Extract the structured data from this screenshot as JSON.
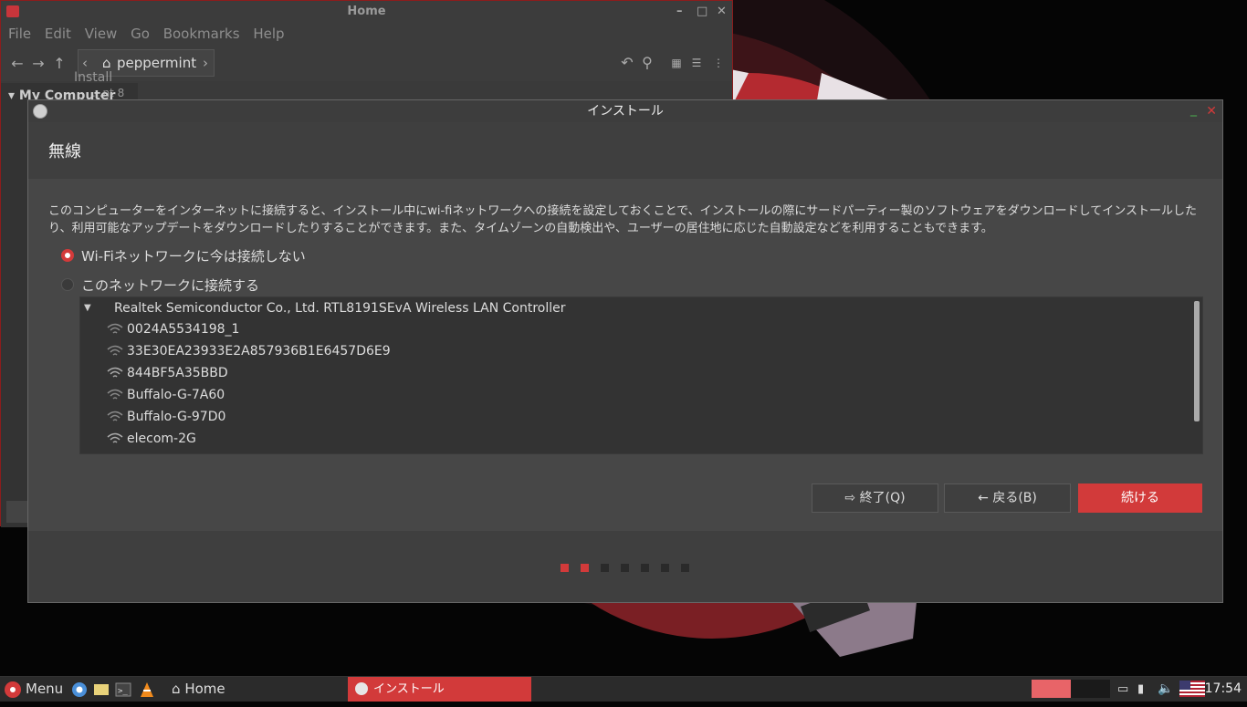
{
  "file_manager": {
    "title": "Home",
    "menu": [
      "File",
      "Edit",
      "View",
      "Go",
      "Bookmarks",
      "Help"
    ],
    "location": "peppermint",
    "sidebar_section": "My Computer",
    "desktop_labels": [
      "Install",
      "...nt 8"
    ]
  },
  "dialog": {
    "title": "インストール",
    "header": "無線",
    "description": "このコンピューターをインターネットに接続すると、インストール中にwi-fiネットワークへの接続を設定しておくことで、インストールの際にサードパーティー製のソフトウェアをダウンロードしてインストールしたり、利用可能なアップデートをダウンロードしたりすることができます。また、タイムゾーンの自動検出や、ユーザーの居住地に応じた自動設定などを利用することもできます。",
    "radio_off_label": "Wi-Fiネットワークに今は接続しない",
    "radio_on_label": "このネットワークに接続する",
    "adapter": "Realtek Semiconductor Co., Ltd. RTL8191SEvA Wireless LAN Controller",
    "networks": [
      "0024A5534198_1",
      "33E30EA23933E2A857936B1E6457D6E9",
      "844BF5A35BBD",
      "Buffalo-G-7A60",
      "Buffalo-G-97D0",
      "elecom-2G"
    ],
    "buttons": {
      "quit": "終了(Q)",
      "back": "戻る(B)",
      "next": "続ける"
    },
    "progress": {
      "total": 7,
      "current": 2
    }
  },
  "taskbar": {
    "menu": "Menu",
    "home": "Home",
    "active_task": "インストール",
    "clock": "17:54"
  },
  "colors": {
    "accent": "#d23a3a"
  }
}
